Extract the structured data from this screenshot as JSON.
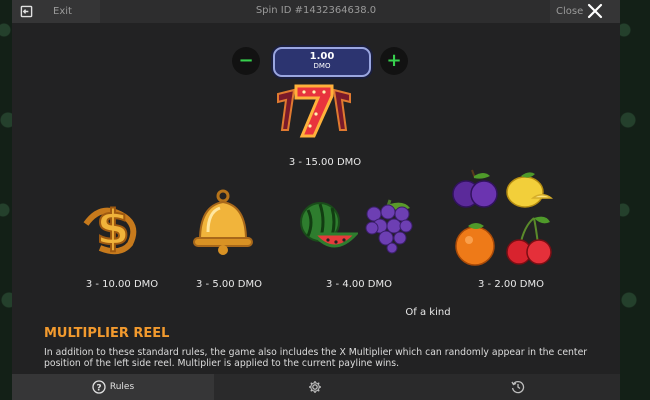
{
  "header": {
    "exit_label": "Exit",
    "spin_id": "Spin ID #1432364638.0",
    "close_label": "Close"
  },
  "bet": {
    "value": "1.00",
    "unit": "DMO"
  },
  "paytable": {
    "sevens": "3 - 15.00 DMO",
    "dollar": "3 - 10.00 DMO",
    "bell": "3 - 5.00 DMO",
    "melon_grapes": "3 - 4.00 DMO",
    "fruits": "3 - 2.00 DMO",
    "of_a_kind": "Of a kind"
  },
  "multiplier": {
    "title": "MULTIPLIER REEL",
    "body": "In addition to these standard rules, the game also includes the X Multiplier which can randomly appear in the center position of the left side reel. Multiplier is applied to the current payline wins."
  },
  "tabs": {
    "rules_label": "Rules"
  },
  "colors": {
    "accent_orange": "#f29a2e",
    "plus_minus_green": "#37d04d",
    "bet_blue": "#2c3470"
  },
  "icons": [
    "exit-icon",
    "close-icon",
    "minus-icon",
    "plus-icon",
    "sevens-symbol",
    "dollar-symbol",
    "bell-symbol",
    "watermelon-symbol",
    "grapes-symbol",
    "plum-symbol",
    "lemon-symbol",
    "orange-symbol",
    "cherry-symbol",
    "help-icon",
    "gear-icon",
    "history-icon"
  ]
}
